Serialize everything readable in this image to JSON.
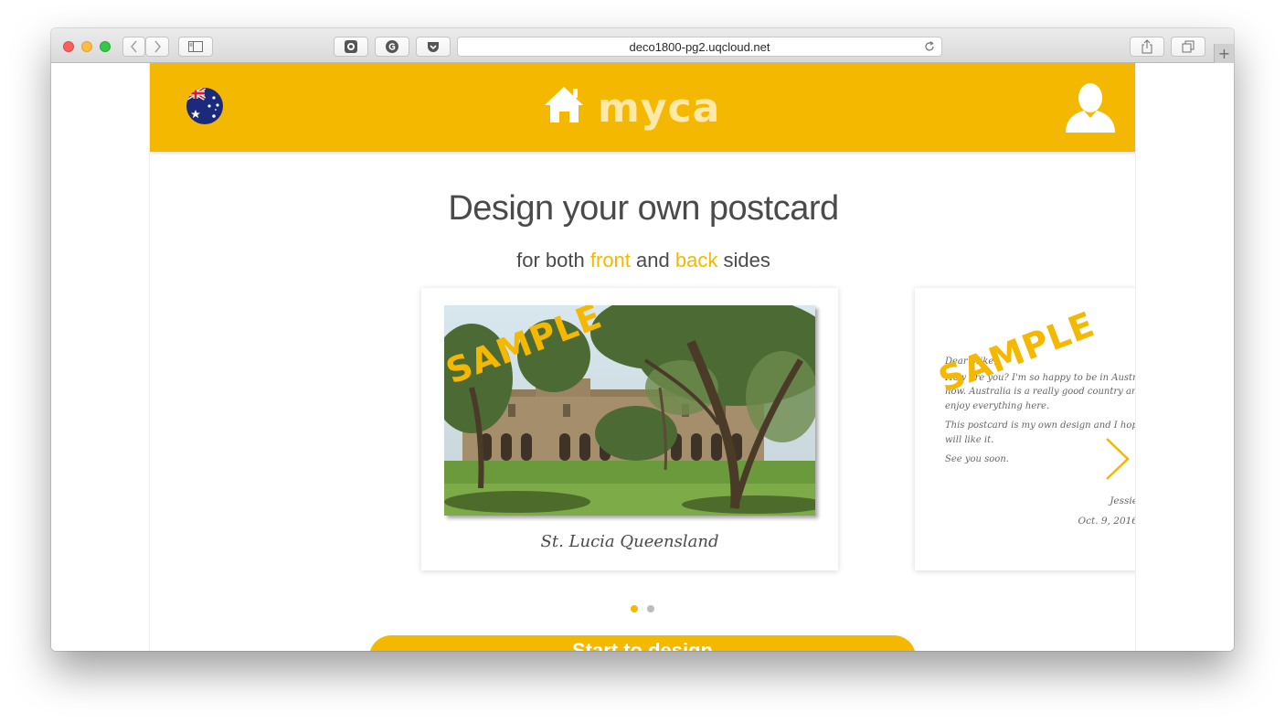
{
  "browser": {
    "url": "deco1800-pg2.uqcloud.net",
    "add_tab_label": "+"
  },
  "header": {
    "logo_text": "myca"
  },
  "main": {
    "title": "Design your own postcard",
    "subtitle": {
      "prefix": "for both",
      "front": "front",
      "middle": "and",
      "back": "back",
      "suffix": "sides"
    },
    "cta_label": "Start to design"
  },
  "carousel": {
    "front_card": {
      "watermark": "SAMPLE",
      "caption": "St. Lucia Queensland"
    },
    "back_card": {
      "watermark": "SAMPLE",
      "greeting": "Dear Mike,",
      "paragraph1": "How are you? I'm so happy to be in Australia now. Australia is a really good country and I enjoy everything here.",
      "paragraph2": "This postcard is my own design and I hope you will like it.",
      "closing": "See you soon.",
      "signature": "Jessie",
      "date": "Oct. 9, 2016"
    },
    "dots": 2,
    "active_dot": 1
  },
  "colors": {
    "brand_yellow": "#f5b800",
    "text_dark": "#4a4a4a"
  }
}
